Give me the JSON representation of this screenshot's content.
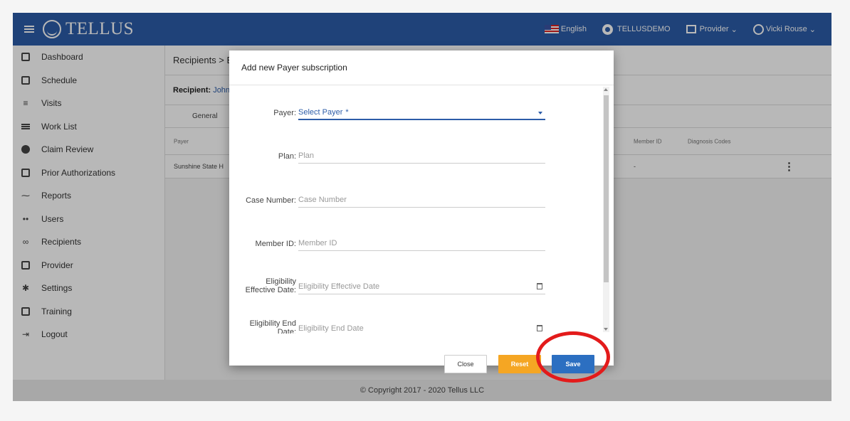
{
  "header": {
    "app_name": "TELLUS",
    "language": "English",
    "account": "TELLUSDEMO",
    "role": "Provider",
    "user": "Vicki Rouse"
  },
  "sidebar": {
    "items": [
      {
        "label": "Dashboard",
        "icon": "dashboard-icon"
      },
      {
        "label": "Schedule",
        "icon": "calendar-icon"
      },
      {
        "label": "Visits",
        "icon": "filter-icon"
      },
      {
        "label": "Work List",
        "icon": "list-icon"
      },
      {
        "label": "Claim Review",
        "icon": "alert-icon"
      },
      {
        "label": "Prior Authorizations",
        "icon": "calendar-icon"
      },
      {
        "label": "Reports",
        "icon": "trend-icon"
      },
      {
        "label": "Users",
        "icon": "group-icon"
      },
      {
        "label": "Recipients",
        "icon": "people-icon"
      },
      {
        "label": "Provider",
        "icon": "clipboard-icon"
      },
      {
        "label": "Settings",
        "icon": "gear-icon"
      },
      {
        "label": "Training",
        "icon": "training-icon"
      },
      {
        "label": "Logout",
        "icon": "logout-icon"
      }
    ]
  },
  "main": {
    "breadcrumb": "Recipients > E",
    "recipient_label": "Recipient:",
    "recipient_name": "John",
    "tab": "General",
    "table": {
      "headers": [
        "Payer",
        "Member ID",
        "Diagnosis Codes"
      ],
      "rows": [
        {
          "payer": "Sunshine State H",
          "member_id": "-"
        }
      ]
    }
  },
  "modal": {
    "title": "Add new Payer subscription",
    "fields": {
      "payer_label": "Payer:",
      "payer_value": "Select Payer",
      "payer_required": "*",
      "plan_label": "Plan:",
      "plan_placeholder": "Plan",
      "case_label": "Case Number:",
      "case_placeholder": "Case Number",
      "member_label": "Member ID:",
      "member_placeholder": "Member ID",
      "elig_eff_label_1": "Eligibility",
      "elig_eff_label_2": "Effective Date:",
      "elig_eff_placeholder": "Eligibility Effective Date",
      "elig_end_label_1": "Eligibility End",
      "elig_end_label_2": "Date:",
      "elig_end_placeholder": "Eligibility End Date"
    },
    "buttons": {
      "close": "Close",
      "reset": "Reset",
      "save": "Save"
    }
  },
  "footer": "© Copyright 2017 - 2020 Tellus LLC",
  "colors": {
    "brand": "#2c5ca8",
    "reset": "#f5a623",
    "save": "#2c6fc1",
    "highlight": "#e31b1b"
  }
}
